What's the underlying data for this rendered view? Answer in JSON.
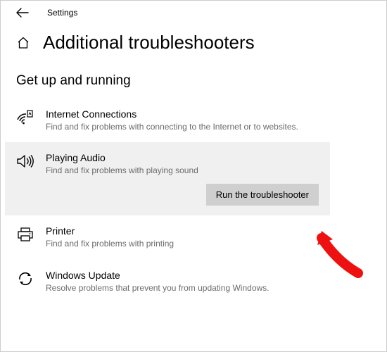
{
  "header": {
    "app_title": "Settings"
  },
  "page": {
    "title": "Additional troubleshooters"
  },
  "section": {
    "title": "Get up and running"
  },
  "items": [
    {
      "icon": "wifi-diag-icon",
      "name": "Internet Connections",
      "desc": "Find and fix problems with connecting to the Internet or to websites."
    },
    {
      "icon": "speaker-icon",
      "name": "Playing Audio",
      "desc": "Find and fix problems with playing sound",
      "selected": true
    },
    {
      "icon": "printer-icon",
      "name": "Printer",
      "desc": "Find and fix problems with printing"
    },
    {
      "icon": "update-icon",
      "name": "Windows Update",
      "desc": "Resolve problems that prevent you from updating Windows."
    }
  ],
  "buttons": {
    "run": "Run the troubleshooter"
  }
}
